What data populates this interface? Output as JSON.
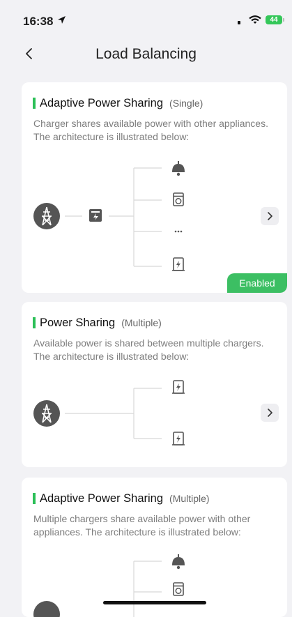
{
  "status_bar": {
    "time": "16:38",
    "battery": "44"
  },
  "nav": {
    "title": "Load Balancing"
  },
  "cards": [
    {
      "title": "Adaptive Power Sharing",
      "subtitle": "(Single)",
      "description": "Charger shares available power with other appliances. The architecture is illustrated below:",
      "badge": "Enabled",
      "diagram_branches": [
        "lamp-icon",
        "washing-machine-icon",
        "ellipsis",
        "charger-icon"
      ]
    },
    {
      "title": "Power Sharing",
      "subtitle": "(Multiple)",
      "description": "Available power is shared between multiple chargers. The architecture is illustrated below:",
      "diagram_branches": [
        "charger-icon",
        "charger-icon"
      ]
    },
    {
      "title": "Adaptive Power Sharing",
      "subtitle": "(Multiple)",
      "description": "Multiple chargers share available power with other appliances. The architecture is illustrated below:",
      "diagram_branches": [
        "lamp-icon",
        "washing-machine-icon"
      ]
    }
  ],
  "colors": {
    "accent": "#2bbf57",
    "badge": "#3cbf63",
    "background": "#f2f2f5",
    "icon": "#555555"
  },
  "ellipsis_text": "..."
}
